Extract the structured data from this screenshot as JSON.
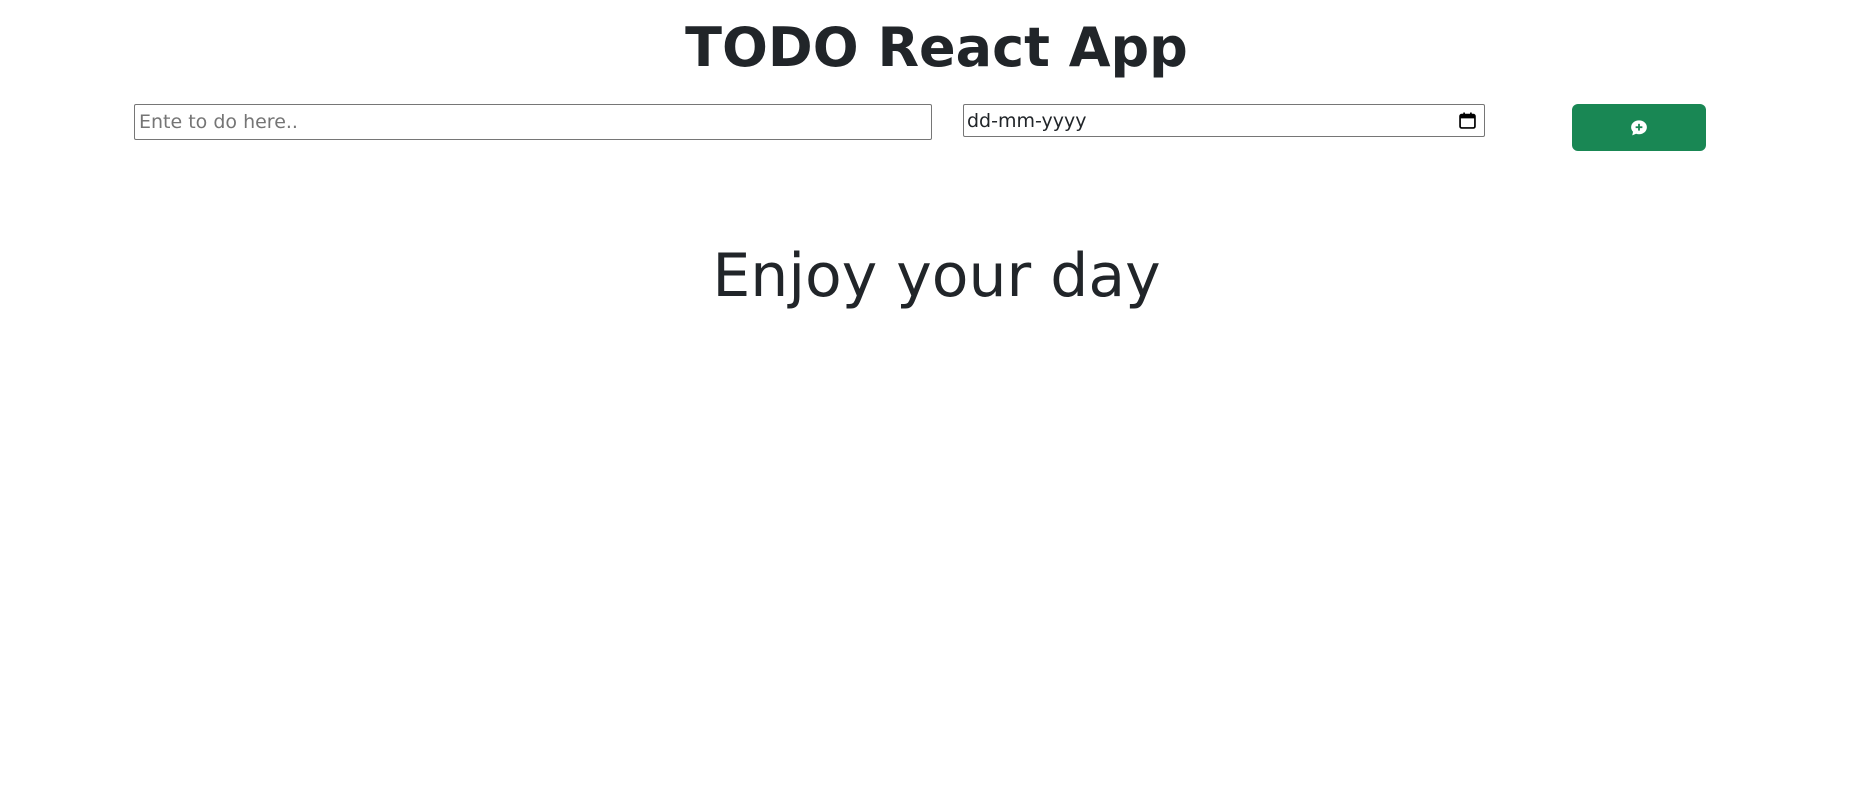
{
  "header": {
    "title": "TODO React App"
  },
  "form": {
    "todo_placeholder": "Ente to do here..",
    "todo_value": "",
    "date_placeholder": "dd-mm-yyyy",
    "date_icon": "calendar-icon",
    "add_button_icon": "chat-plus-icon"
  },
  "main": {
    "empty_message": "Enjoy your day"
  },
  "colors": {
    "accent": "#198754",
    "text": "#212529"
  }
}
